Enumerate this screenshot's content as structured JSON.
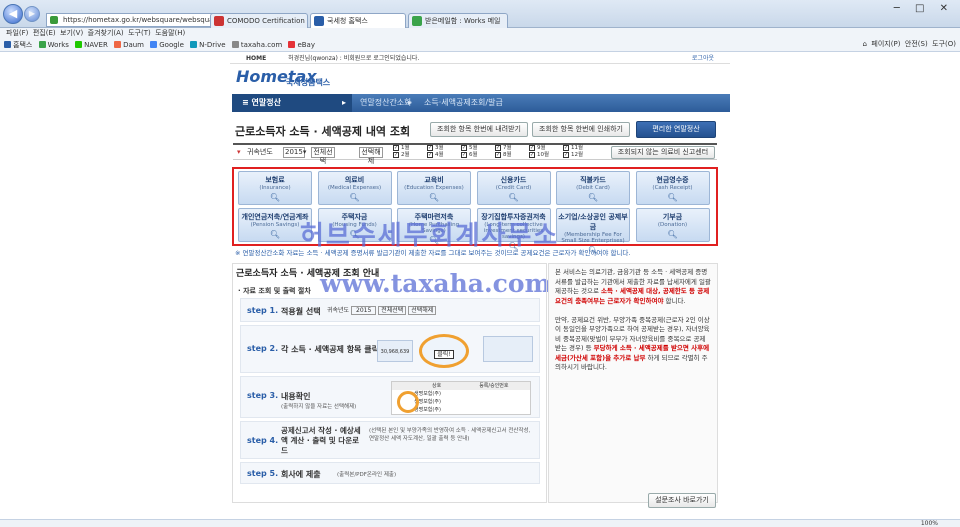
{
  "browser": {
    "url": "https://hometax.go.kr/websquare/websquare_cdn.html?...",
    "tabs": [
      "COMODO Certification ...",
      "국세청 홈택스",
      "받은메일함 : Works 메일"
    ],
    "menu": [
      "파일(F)",
      "편집(E)",
      "보기(V)",
      "즐겨찾기(A)",
      "도구(T)",
      "도움말(H)"
    ],
    "favorites": [
      "홈택스",
      "Works",
      "NAVER",
      "Daum",
      "Google",
      "N-Drive",
      "taxaha.com",
      "eBay"
    ],
    "commands": [
      "페이지(P)",
      "안전(S)",
      "도구(O)"
    ],
    "zoom": "100%"
  },
  "site": {
    "home": "HOME",
    "login_text": "허경진님(qwonza) : 비회원으로 로그인되었습니다.",
    "logout": "로그아웃",
    "logo": "Hometax",
    "logo_sub": "국세청홈택스",
    "nav_main": "연말정산",
    "nav_crumb1": "연말정산간소화",
    "nav_crumb2": "소득·세액공제조회/발급"
  },
  "main": {
    "title": "근로소득자 소득 · 세액공제 내역 조회",
    "btn_download": "조회한 항목 한번에 내려받기",
    "btn_print": "조회한 항목 한번에 인쇄하기",
    "btn_convenient": "편리한 연말정산",
    "filter_label": "귀속년도",
    "year": "2015",
    "select_all": "전체선택",
    "deselect": "선택해제",
    "months": [
      "1월",
      "2월",
      "3월",
      "4월",
      "5월",
      "6월",
      "7월",
      "8월",
      "9월",
      "10월",
      "11월",
      "12월"
    ],
    "report_btn": "조회되지 않는 의료비 신고센터"
  },
  "categories": [
    {
      "ko": "보험료",
      "en": "(Insurance)"
    },
    {
      "ko": "의료비",
      "en": "(Medical Expenses)"
    },
    {
      "ko": "교육비",
      "en": "(Education Expenses)"
    },
    {
      "ko": "신용카드",
      "en": "(Credit Card)"
    },
    {
      "ko": "직불카드",
      "en": "(Debit Card)"
    },
    {
      "ko": "현금영수증",
      "en": "(Cash Receipt)"
    },
    {
      "ko": "개인연금저축/연금계좌",
      "en": "(Pension Savings)"
    },
    {
      "ko": "주택자금",
      "en": "(Housing Funds)"
    },
    {
      "ko": "주택마련저축",
      "en": "(Home Purchasing Savings)"
    },
    {
      "ko": "장기집합투자증권저축",
      "en": "(Long-term collective investment securities savings)"
    },
    {
      "ko": "소기업/소상공인 공제부금",
      "en": "(Membership Fee For Small Size Enterprises)"
    },
    {
      "ko": "기부금",
      "en": "(Donation)"
    }
  ],
  "notice": "※ 연말정산간소화 자료는 소득 · 세액공제 증명서류 발급기관이 제출한 자료를 그대로 보여주는 것이므로 공제요건은 근로자가 확인하여야 합니다.",
  "watermark1": "허브수세무회계사무소",
  "watermark2": "www.taxaha.com",
  "guide": {
    "title": "근로소득자 소득 · 세액공제 조회 안내",
    "subtitle": "· 자료 조회 및 출력 절차",
    "step1_label": "step 1.",
    "step1_text": "적용월 선택",
    "step2_label": "step 2.",
    "step2_text": "각 소득 · 세액공제 항목 클릭",
    "step2_click": "클릭!",
    "step2_amount": "30,968,639",
    "step3_label": "step 3.",
    "step3_text": "내용확인",
    "step3_sub": "(출력하지 않을 자료는 선택해제)",
    "step3_col1": "상호",
    "step3_col2": "등록/승인번호",
    "step3_rows": [
      "생명보험(주)",
      "생명보험(주)",
      "생명보험(주)"
    ],
    "step4_label": "step 4.",
    "step4_text": "공제신고서 작성 · 예상세액 계산 · 출력 및 다운로드",
    "step4_sub": "(선택된 본인 및 부양가족의 반영하여 소득 · 세액공제신고서 전산작성, 연말정산 세액 자도계산, 일괄 출력 등 안내)",
    "step5_label": "step 5.",
    "step5_text": "회사에 제출",
    "step5_sub": "(출력본/PDF온라인 제출)"
  },
  "side": {
    "p1a": "본 서비스는 의료기관, 금융기관 등 소득 · 세액공제 증명서류를 발급하는 기관에서 제출한 자료를 납세자에게 일괄 제공하는 것으로",
    "p1b": "소득 · 세액공제 대상, 공제한도 등 공제요건의 충족여부는 근로자가 확인하여야",
    "p1c": "합니다.",
    "p2a": "만약, 공제요건 위반, 부양가족 중복공제(근로자 2인 이상이 동일인을 부양가족으로 하여 공제받는 경우), 자녀양육비 중복공제(맞벌이 부부가 자녀양육비를 중복으로 공제받는 경우) 등",
    "p2b": "부당하게 소득 · 세액공제를 받으면 사후에 세금(가산세 포함)을 추가로 납부",
    "p2c": "하게 되므로 각별히 주의하시기 바랍니다.",
    "survey_btn": "설문조사 바로가기"
  }
}
